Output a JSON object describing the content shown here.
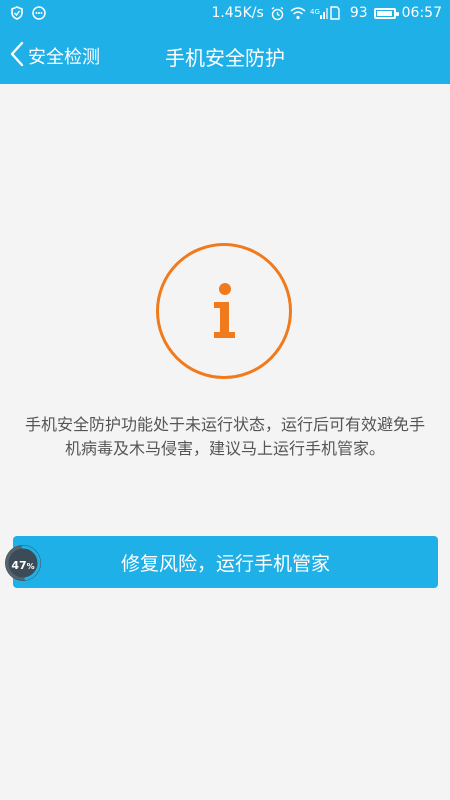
{
  "status_bar": {
    "speed": "1.45K/s",
    "battery": "93",
    "time": "06:57",
    "battery_level_percent": 93
  },
  "header": {
    "back_label": "安全检测",
    "title": "手机安全防护"
  },
  "main": {
    "message": "手机安全防护功能处于未运行状态，运行后可有效避免手机病毒及木马侵害，建议马上运行手机管家。",
    "info_icon": "info-icon",
    "accent_color": "#f07a1c"
  },
  "action": {
    "button_label": "修复风险，运行手机管家"
  },
  "progress": {
    "value": "47",
    "unit": "%",
    "percent": 47
  },
  "colors": {
    "brand": "#1fb0e8",
    "text": "#555555"
  }
}
